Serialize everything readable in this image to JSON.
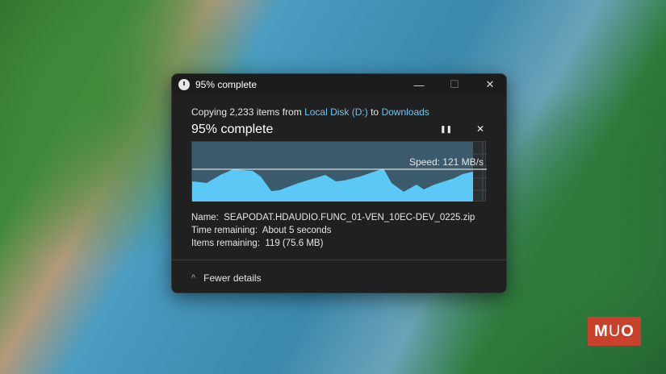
{
  "window": {
    "title": "95% complete",
    "minimize": "—",
    "maximize": "☐",
    "close": "✕"
  },
  "dialog": {
    "copying_prefix": "Copying 2,233 items from ",
    "source": "Local Disk (D:)",
    "to": " to ",
    "destination": "Downloads",
    "status": "95% complete",
    "pause": "❚❚",
    "cancel": "✕",
    "progress": 0.95,
    "speed": "Speed: 121 MB/s",
    "name_label": "Name:",
    "name_value": "SEAPODAT.HDAUDIO.FUNC_01-VEN_10EC-DEV_0225.zip",
    "time_label": "Time remaining:",
    "time_value": "About 5 seconds",
    "items_label": "Items remaining:",
    "items_value": "119 (75.6 MB)",
    "fewer_details": "Fewer details",
    "chevron": "^"
  },
  "colors": {
    "fill": "#5cc8f5",
    "link": "#6cc6f0"
  },
  "watermark": "MUO"
}
